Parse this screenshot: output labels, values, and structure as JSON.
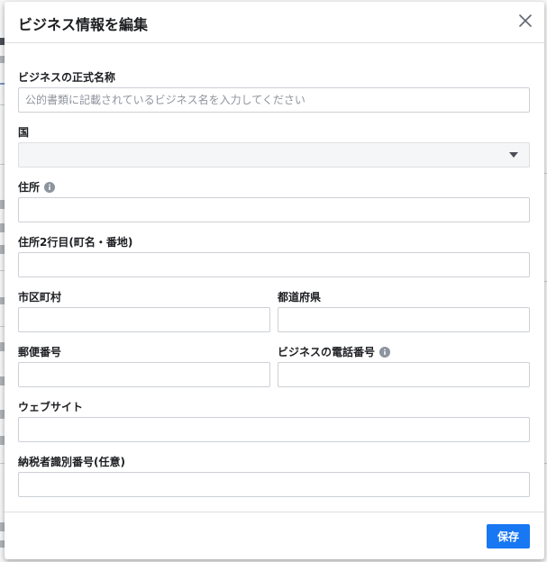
{
  "dialog": {
    "title": "ビジネス情報を編集",
    "close_icon": "close-icon"
  },
  "form": {
    "legal_name": {
      "label": "ビジネスの正式名称",
      "placeholder": "公的書類に記載されているビジネス名を入力してください",
      "value": ""
    },
    "country": {
      "label": "国",
      "value": ""
    },
    "address": {
      "label": "住所",
      "info_icon": "info-icon",
      "value": ""
    },
    "address2": {
      "label": "住所2行目(町名・番地)",
      "value": ""
    },
    "city": {
      "label": "市区町村",
      "value": ""
    },
    "state": {
      "label": "都道府県",
      "value": ""
    },
    "postal_code": {
      "label": "郵便番号",
      "value": ""
    },
    "phone": {
      "label": "ビジネスの電話番号",
      "info_icon": "info-icon",
      "value": ""
    },
    "website": {
      "label": "ウェブサイト",
      "value": ""
    },
    "tax_id": {
      "label": "納税者識別番号(任意)",
      "value": ""
    }
  },
  "footer": {
    "save_label": "保存"
  },
  "colors": {
    "primary": "#1877f2",
    "border": "#ccd0d5",
    "text": "#1c1e21",
    "placeholder": "#90949c"
  }
}
